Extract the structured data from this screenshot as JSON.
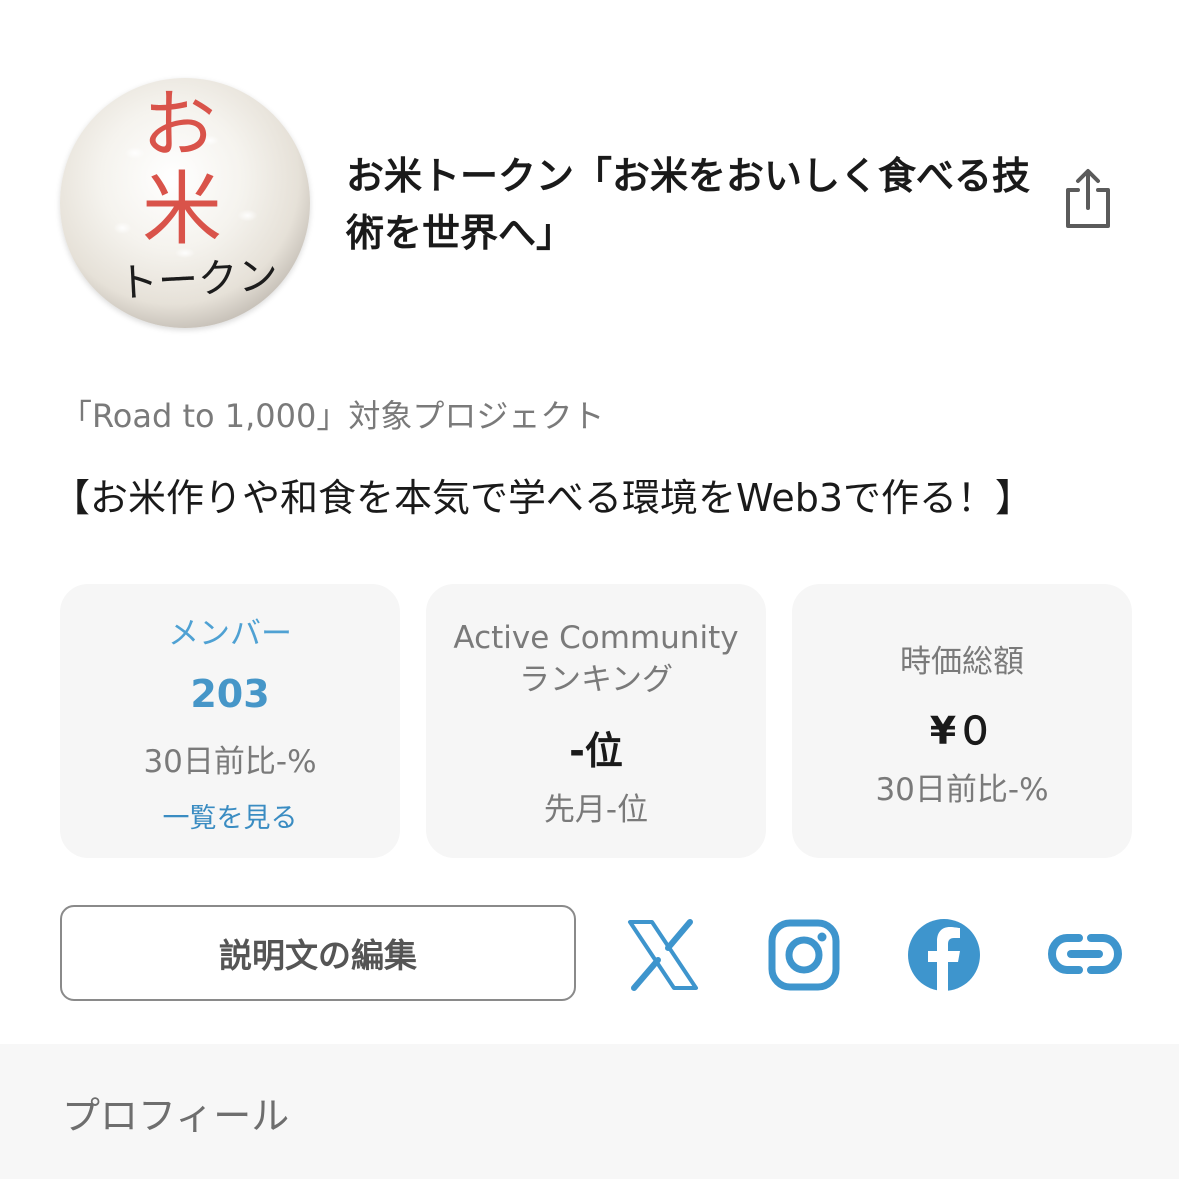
{
  "header": {
    "avatar_text": {
      "line1": "お",
      "line2": "米",
      "line3": "トークン"
    },
    "title": "お米トークン「お米をおいしく食べる技術を世界へ」",
    "share_icon": "share-icon"
  },
  "road_label": "「Road to 1,000」対象プロジェクト",
  "tagline": "【お米作りや和食を本気で学べる環境をWeb3で作る！】",
  "stats": {
    "members": {
      "label": "メンバー",
      "value": "203",
      "change": "30日前比-%",
      "link": "一覧を見る"
    },
    "ranking": {
      "label_line1": "Active Community",
      "label_line2": "ランキング",
      "value": "-位",
      "prev": "先月-位"
    },
    "market_cap": {
      "label": "時価総額",
      "value": "¥０",
      "change": "30日前比-%"
    }
  },
  "actions": {
    "edit_label": "説明文の編集",
    "social_icons": [
      "x-icon",
      "instagram-icon",
      "facebook-icon",
      "link-icon"
    ]
  },
  "profile": {
    "title": "プロフィール"
  },
  "colors": {
    "accent_blue": "#4fa1d3",
    "card_bg": "#f6f6f6",
    "avatar_red": "#d9534a"
  }
}
